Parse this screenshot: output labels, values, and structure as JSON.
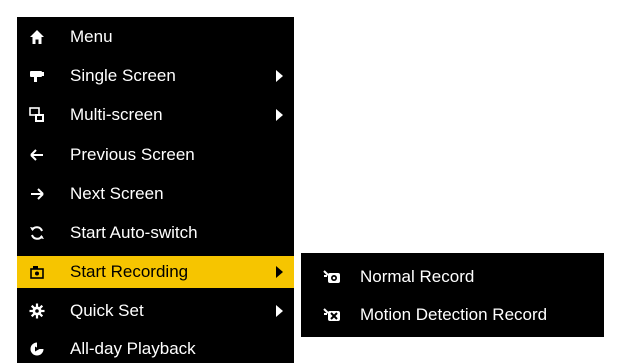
{
  "menu": {
    "items": [
      {
        "label": "Menu",
        "icon": "home-icon",
        "has_submenu": false
      },
      {
        "label": "Single Screen",
        "icon": "camera-icon",
        "has_submenu": true
      },
      {
        "label": "Multi-screen",
        "icon": "multi-screen-icon",
        "has_submenu": true
      },
      {
        "label": "Previous Screen",
        "icon": "arrow-left-icon",
        "has_submenu": false
      },
      {
        "label": "Next Screen",
        "icon": "arrow-right-icon",
        "has_submenu": false
      },
      {
        "label": "Start Auto-switch",
        "icon": "cycle-icon",
        "has_submenu": false
      },
      {
        "label": "Start Recording",
        "icon": "record-icon",
        "has_submenu": true,
        "selected": true
      },
      {
        "label": "Quick Set",
        "icon": "gear-icon",
        "has_submenu": true
      },
      {
        "label": "All-day Playback",
        "icon": "playback-icon",
        "has_submenu": false
      }
    ]
  },
  "submenu": {
    "items": [
      {
        "label": "Normal Record",
        "icon": "normal-record-icon"
      },
      {
        "label": "Motion Detection Record",
        "icon": "motion-record-icon"
      }
    ]
  },
  "colors": {
    "menu_bg": "#000000",
    "text": "#ffffff",
    "highlight": "#f6c500"
  }
}
